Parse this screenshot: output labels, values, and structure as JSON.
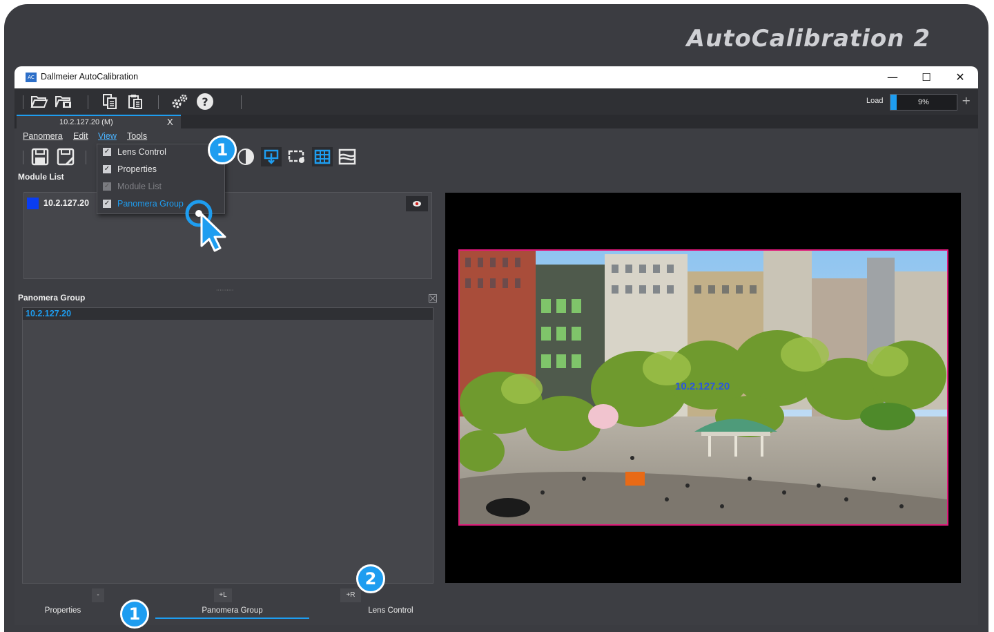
{
  "brand": "AutoCalibration 2",
  "window": {
    "title": "Dallmeier AutoCalibration",
    "app_icon_text": "AC",
    "minimize": "—",
    "maximize": "☐",
    "close": "✕"
  },
  "toolbar": {
    "icons": [
      "folder-open-icon",
      "folder-camera-icon",
      "copy-icon",
      "paste-icon",
      "settings-icon",
      "help-icon"
    ],
    "load_label": "Load",
    "load_value_text": "9%",
    "load_fraction": 0.09,
    "load_plus": "+"
  },
  "tab": {
    "label": "10.2.127.20 (M)",
    "close": "X"
  },
  "menu": {
    "items": [
      "Panomera",
      "Edit",
      "View",
      "Tools"
    ],
    "active": "View"
  },
  "view_menu": {
    "items": [
      {
        "label": "Lens Control",
        "checked": true,
        "enabled": true
      },
      {
        "label": "Properties",
        "checked": true,
        "enabled": true
      },
      {
        "label": "Module List",
        "checked": true,
        "enabled": false
      },
      {
        "label": "Panomera Group",
        "checked": true,
        "enabled": true,
        "highlighted": true
      }
    ]
  },
  "module_list": {
    "title": "Module List",
    "items": [
      {
        "label": "10.2.127.20",
        "color": "#0a3df2"
      }
    ]
  },
  "panomera_group": {
    "title": "Panomera Group",
    "rows": [
      "10.2.127.20"
    ]
  },
  "bottom_buttons": {
    "minus": "-",
    "plus_l": "+L",
    "plus_r": "+R"
  },
  "bottom_tabs": {
    "items": [
      "Properties",
      "Panomera Group",
      "Lens Control"
    ],
    "active": "Panomera Group"
  },
  "viewer": {
    "overlay_label": "10.2.127.20",
    "border_color": "#e0187a"
  },
  "callouts": {
    "menu_step": "1",
    "tab_step": "1",
    "plus_r_step": "2"
  },
  "colors": {
    "accent": "#1e9df0",
    "frame": "#3b3c41",
    "panel": "#45464b"
  }
}
